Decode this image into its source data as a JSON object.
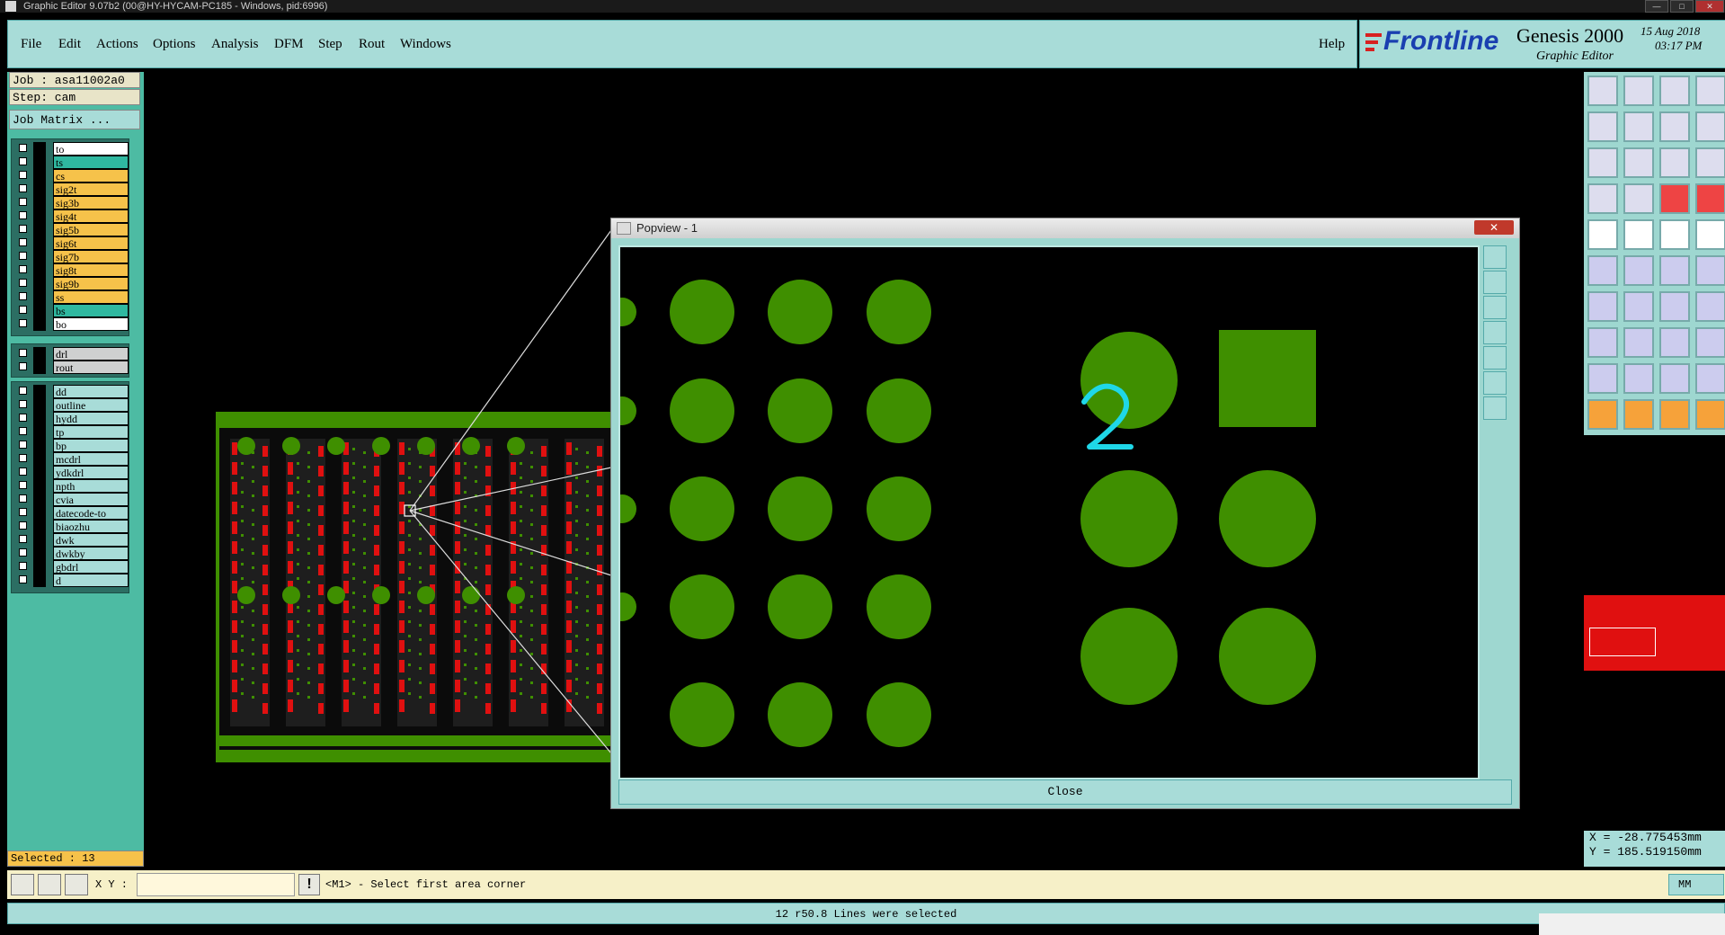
{
  "window": {
    "title": "Graphic Editor 9.07b2 (00@HY-HYCAM-PC185 - Windows, pid:6996)"
  },
  "menu": {
    "items": [
      "File",
      "Edit",
      "Actions",
      "Options",
      "Analysis",
      "DFM",
      "Step",
      "Rout",
      "Windows"
    ],
    "help": "Help"
  },
  "brand": {
    "logo": "Frontline",
    "product": "Genesis 2000",
    "subtitle": "Graphic Editor",
    "date": "15 Aug 2018",
    "time": "03:17 PM"
  },
  "job": {
    "job_label": "Job : asa11002a0",
    "step_label": "Step: cam",
    "matrix_button": "Job Matrix ..."
  },
  "layers": {
    "board": [
      {
        "name": "to",
        "color": "#ffffff"
      },
      {
        "name": "ts",
        "color": "#2fb8a0"
      },
      {
        "name": "cs",
        "color": "#f6c24a"
      },
      {
        "name": "sig2t",
        "color": "#f6c24a"
      },
      {
        "name": "sig3b",
        "color": "#f6c24a"
      },
      {
        "name": "sig4t",
        "color": "#f6c24a"
      },
      {
        "name": "sig5b",
        "color": "#f6c24a"
      },
      {
        "name": "sig6t",
        "color": "#f6c24a"
      },
      {
        "name": "sig7b",
        "color": "#f6c24a"
      },
      {
        "name": "sig8t",
        "color": "#f6c24a"
      },
      {
        "name": "sig9b",
        "color": "#f6c24a"
      },
      {
        "name": "ss",
        "color": "#f6c24a"
      },
      {
        "name": "bs",
        "color": "#2fb8a0"
      },
      {
        "name": "bo",
        "color": "#ffffff"
      }
    ],
    "drill": [
      {
        "name": "drl",
        "color": "#cfd0d0"
      },
      {
        "name": "rout",
        "color": "#cfd0d0"
      }
    ],
    "misc": [
      {
        "name": "dd",
        "color": "#a8dcd8"
      },
      {
        "name": "outline",
        "color": "#a8dcd8"
      },
      {
        "name": "hydd",
        "color": "#a8dcd8"
      },
      {
        "name": "tp",
        "color": "#a8dcd8"
      },
      {
        "name": "bp",
        "color": "#a8dcd8"
      },
      {
        "name": "mcdrl",
        "color": "#a8dcd8"
      },
      {
        "name": "ydkdrl",
        "color": "#a8dcd8"
      },
      {
        "name": "npth",
        "color": "#a8dcd8"
      },
      {
        "name": "cvia",
        "color": "#a8dcd8"
      },
      {
        "name": "datecode-to",
        "color": "#a8dcd8"
      },
      {
        "name": "biaozhu",
        "color": "#a8dcd8"
      },
      {
        "name": "dwk",
        "color": "#a8dcd8"
      },
      {
        "name": "dwkby",
        "color": "#a8dcd8"
      },
      {
        "name": "gbdrl",
        "color": "#a8dcd8"
      },
      {
        "name": "d",
        "color": "#a8dcd8"
      }
    ]
  },
  "selected_count": "Selected : 13",
  "popview": {
    "title": "Popview - 1",
    "close_label": "Close",
    "annotation": "2"
  },
  "coords": {
    "x": "X = -28.775453mm",
    "y": "Y = 185.519150mm"
  },
  "command": {
    "xy_label": "X Y :",
    "xy_value": "",
    "warn": "!",
    "prompt": "<M1> - Select first area corner",
    "units": "MM"
  },
  "status": "12 r50.8 Lines were selected",
  "colors": {
    "panel": "#a8dcd8",
    "sidebar": "#4dbba3",
    "pad_green": "#3f8f00",
    "trace_red": "#e01010",
    "highlight_cyan": "#1fd7e8"
  }
}
